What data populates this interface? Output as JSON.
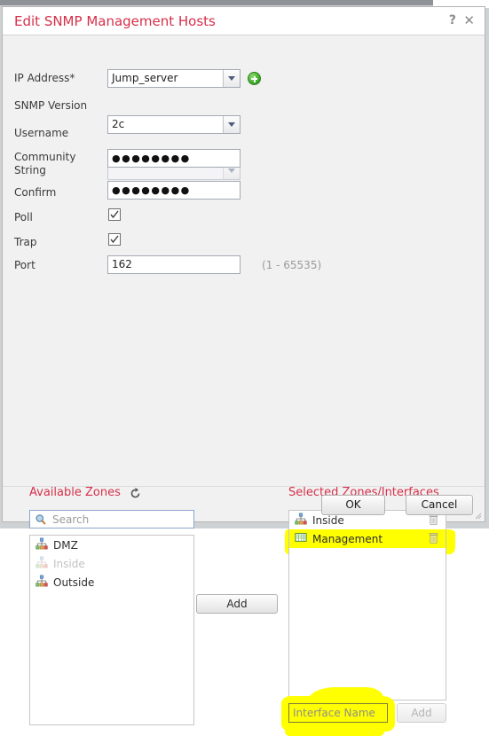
{
  "window": {
    "title": "Edit SNMP Management Hosts",
    "help_icon": "?",
    "close_icon": "✕"
  },
  "form": {
    "fields": [
      {
        "label": "IP Address*",
        "type": "select",
        "value": "Jump_server",
        "has_add_button": true,
        "disabled": false
      },
      {
        "label": "SNMP Version",
        "type": "select",
        "value": "2c",
        "has_add_button": false,
        "disabled": false
      },
      {
        "label": "Username",
        "type": "select",
        "value": "",
        "has_add_button": false,
        "disabled": true
      },
      {
        "label": "Community String",
        "type": "password",
        "value": "●●●●●●●●",
        "has_add_button": false,
        "disabled": false
      },
      {
        "label": "Confirm",
        "type": "password",
        "value": "●●●●●●●●",
        "has_add_button": false,
        "disabled": false
      }
    ],
    "poll_label": "Poll",
    "poll_checked": true,
    "trap_label": "Trap",
    "trap_checked": true,
    "port_label": "Port",
    "port_value": "162",
    "port_hint": "(1 - 65535)"
  },
  "available": {
    "title": "Available Zones",
    "refresh_icon": "refresh-icon",
    "search_placeholder": "Search",
    "items": [
      {
        "label": "DMZ",
        "icon": "zone-icon",
        "disabled": false
      },
      {
        "label": "Inside",
        "icon": "zone-icon",
        "disabled": true
      },
      {
        "label": "Outside",
        "icon": "zone-icon",
        "disabled": false
      }
    ]
  },
  "add_button_label": "Add",
  "selected": {
    "title": "Selected Zones/Interfaces",
    "items": [
      {
        "label": "Inside",
        "icon": "zone-icon",
        "highlighted": false
      },
      {
        "label": "Management",
        "icon": "interface-icon",
        "highlighted": true
      }
    ],
    "interface_input_placeholder": "Interface Name",
    "interface_input_value": "",
    "interface_add_label": "Add"
  },
  "footer": {
    "ok_label": "OK",
    "cancel_label": "Cancel"
  },
  "colors": {
    "title_red": "#d6304a",
    "highlight_yellow": "#ffff00",
    "dialog_bg": "#f1f1f1",
    "backdrop": "#cfd2d4"
  }
}
